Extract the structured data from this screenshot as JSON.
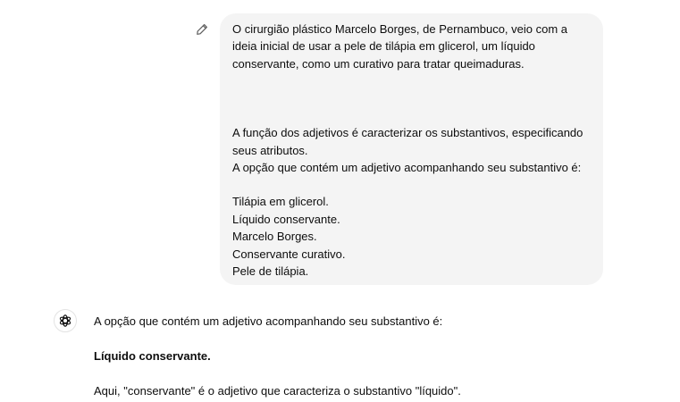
{
  "user_message": {
    "paragraph_1": "O cirurgião plástico Marcelo Borges, de Pernambuco, veio com a ideia inicial de usar a pele de tilápia em glicerol, um líquido conservante, como um curativo para tratar queimaduras.",
    "paragraph_2": "A função dos adjetivos é caracterizar os substantivos, especificando seus atributos.\nA opção que contém um adjetivo acompanhando seu substantivo é:",
    "options": [
      "Tilápia em glicerol.",
      "Líquido conservante.",
      "Marcelo Borges.",
      "Conservante curativo.",
      "Pele de tilápia."
    ],
    "edit_icon": "pencil-icon"
  },
  "assistant_message": {
    "avatar_icon": "openai-logo-icon",
    "intro": "A opção que contém um adjetivo acompanhando seu substantivo é:",
    "answer": "Líquido conservante.",
    "explanation": "Aqui, \"conservante\" é o adjetivo que caracteriza o substantivo \"líquido\"."
  },
  "colors": {
    "bubble_background": "#f4f4f4",
    "text": "#0d0d0d",
    "icon": "#5d5d5d"
  }
}
